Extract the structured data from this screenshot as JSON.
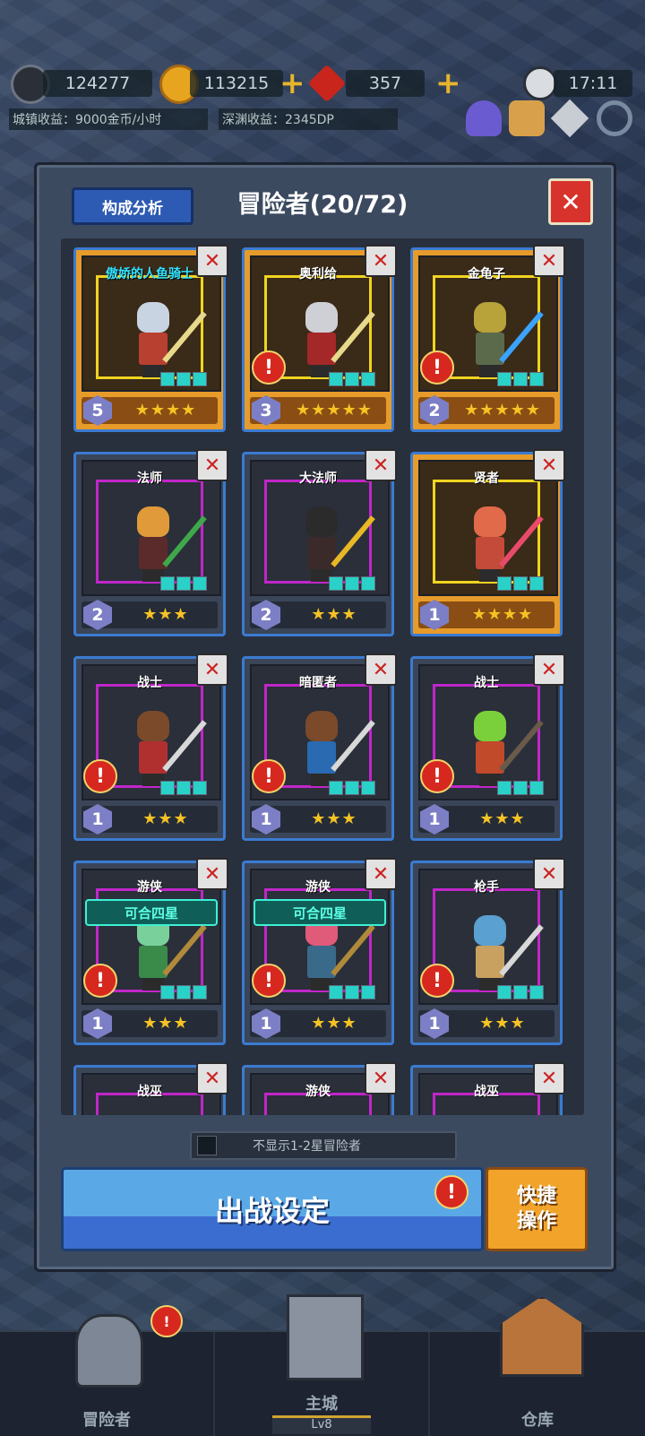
{
  "header": {
    "resources": {
      "dp": "124277",
      "gold": "113215",
      "gems": "357",
      "time": "17:11"
    },
    "income": {
      "town": "城镇收益：9000金币/小时",
      "abyss": "深渊收益：2345DP"
    }
  },
  "panel": {
    "analysis_label": "构成分析",
    "title": "冒险者(20/72)",
    "close_label": "✕"
  },
  "cards": [
    {
      "name": "傲娇的人鱼骑士",
      "level": "5",
      "stars": "★★★★",
      "gold": true,
      "alert": false,
      "combine": "",
      "name_cyan": true,
      "hair": "#c9d4e2",
      "body": "#b84030",
      "weapon": "#e7d98a"
    },
    {
      "name": "奥利给",
      "level": "3",
      "stars": "★★★★★",
      "gold": true,
      "alert": true,
      "combine": "",
      "name_cyan": false,
      "hair": "#cfcfd6",
      "body": "#a42828",
      "weapon": "#e7d98a"
    },
    {
      "name": "金龟子",
      "level": "2",
      "stars": "★★★★★",
      "gold": true,
      "alert": true,
      "combine": "",
      "name_cyan": false,
      "hair": "#b8a23a",
      "body": "#5a6a4a",
      "weapon": "#3aa3ff"
    },
    {
      "name": "法师",
      "level": "2",
      "stars": "★★★",
      "gold": false,
      "alert": false,
      "combine": "",
      "name_cyan": false,
      "hair": "#e09a3a",
      "body": "#5b2a2a",
      "weapon": "#3fa84a"
    },
    {
      "name": "大法师",
      "level": "2",
      "stars": "★★★",
      "gold": false,
      "alert": false,
      "combine": "",
      "name_cyan": false,
      "hair": "#2b2b2b",
      "body": "#3a2a2a",
      "weapon": "#e8b825"
    },
    {
      "name": "贤者",
      "level": "1",
      "stars": "★★★★",
      "gold": true,
      "alert": false,
      "combine": "",
      "name_cyan": false,
      "hair": "#e06a4a",
      "body": "#c44a3a",
      "weapon": "#e84a6a"
    },
    {
      "name": "战士",
      "level": "1",
      "stars": "★★★",
      "gold": false,
      "alert": true,
      "combine": "",
      "name_cyan": false,
      "hair": "#7a4a2a",
      "body": "#b03030",
      "weapon": "#d8d8d8"
    },
    {
      "name": "暗匿者",
      "level": "1",
      "stars": "★★★",
      "gold": false,
      "alert": true,
      "combine": "",
      "name_cyan": false,
      "hair": "#7a4a2a",
      "body": "#2a6ab0",
      "weapon": "#d8d8d8"
    },
    {
      "name": "战士",
      "level": "1",
      "stars": "★★★",
      "gold": false,
      "alert": true,
      "combine": "",
      "name_cyan": false,
      "hair": "#7ad03a",
      "body": "#c04a2a",
      "weapon": "#6a5a4a"
    },
    {
      "name": "游侠",
      "level": "1",
      "stars": "★★★",
      "gold": false,
      "alert": true,
      "combine": "可合四星",
      "name_cyan": false,
      "hair": "#7ad09a",
      "body": "#3a8a4a",
      "weapon": "#b08a3a"
    },
    {
      "name": "游侠",
      "level": "1",
      "stars": "★★★",
      "gold": false,
      "alert": true,
      "combine": "可合四星",
      "name_cyan": false,
      "hair": "#e05a7a",
      "body": "#3a6a8a",
      "weapon": "#b08a3a"
    },
    {
      "name": "枪手",
      "level": "1",
      "stars": "★★★",
      "gold": false,
      "alert": true,
      "combine": "",
      "name_cyan": false,
      "hair": "#5aa0d0",
      "body": "#c8a060",
      "weapon": "#d8d8d8"
    },
    {
      "name": "战巫",
      "level": "",
      "stars": "",
      "gold": false,
      "alert": false,
      "combine": "",
      "name_cyan": false,
      "hair": "",
      "body": "",
      "weapon": ""
    },
    {
      "name": "游侠",
      "level": "",
      "stars": "",
      "gold": false,
      "alert": false,
      "combine": "",
      "name_cyan": false,
      "hair": "",
      "body": "",
      "weapon": ""
    },
    {
      "name": "战巫",
      "level": "",
      "stars": "",
      "gold": false,
      "alert": false,
      "combine": "",
      "name_cyan": false,
      "hair": "",
      "body": "",
      "weapon": ""
    }
  ],
  "filter_label": "不显示1-2星冒险者",
  "buttons": {
    "battle": "出战设定",
    "alert": "!",
    "quick": "快捷操作"
  },
  "tabs": {
    "adventurers": "冒险者",
    "main_city": "主城",
    "main_city_level": "Lv8",
    "warehouse": "仓库"
  },
  "colors": {
    "card_border": "#3b7bd1",
    "gold_card": "#e79b2a",
    "alert": "#d6281f"
  }
}
